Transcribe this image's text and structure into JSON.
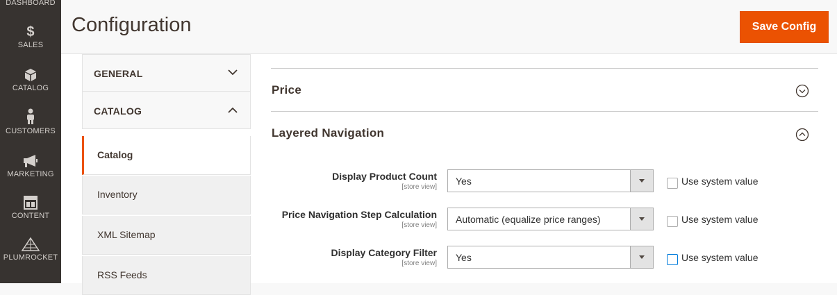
{
  "admin_menu": {
    "items": [
      {
        "label": "DASHBOARD",
        "icon": "dashboard-icon"
      },
      {
        "label": "SALES",
        "icon": "dollar-icon"
      },
      {
        "label": "CATALOG",
        "icon": "box-icon"
      },
      {
        "label": "CUSTOMERS",
        "icon": "person-icon"
      },
      {
        "label": "MARKETING",
        "icon": "megaphone-icon"
      },
      {
        "label": "CONTENT",
        "icon": "layout-icon"
      },
      {
        "label": "PLUMROCKET",
        "icon": "pyramid-icon"
      }
    ]
  },
  "header": {
    "title": "Configuration",
    "save_label": "Save Config"
  },
  "tabs": {
    "general": "GENERAL",
    "catalog": "CATALOG",
    "items": [
      {
        "label": "Catalog"
      },
      {
        "label": "Inventory"
      },
      {
        "label": "XML Sitemap"
      },
      {
        "label": "RSS Feeds"
      }
    ]
  },
  "sections": {
    "price": "Price",
    "layered_navigation": "Layered Navigation"
  },
  "fields": [
    {
      "label": "Display Product Count",
      "scope": "[store view]",
      "value": "Yes",
      "use_system": "Use system value"
    },
    {
      "label": "Price Navigation Step Calculation",
      "scope": "[store view]",
      "value": "Automatic (equalize price ranges)",
      "use_system": "Use system value"
    },
    {
      "label": "Display Category Filter",
      "scope": "[store view]",
      "value": "Yes",
      "use_system": "Use system value"
    }
  ],
  "colors": {
    "accent": "#eb5202",
    "menu_bg": "#373330"
  }
}
